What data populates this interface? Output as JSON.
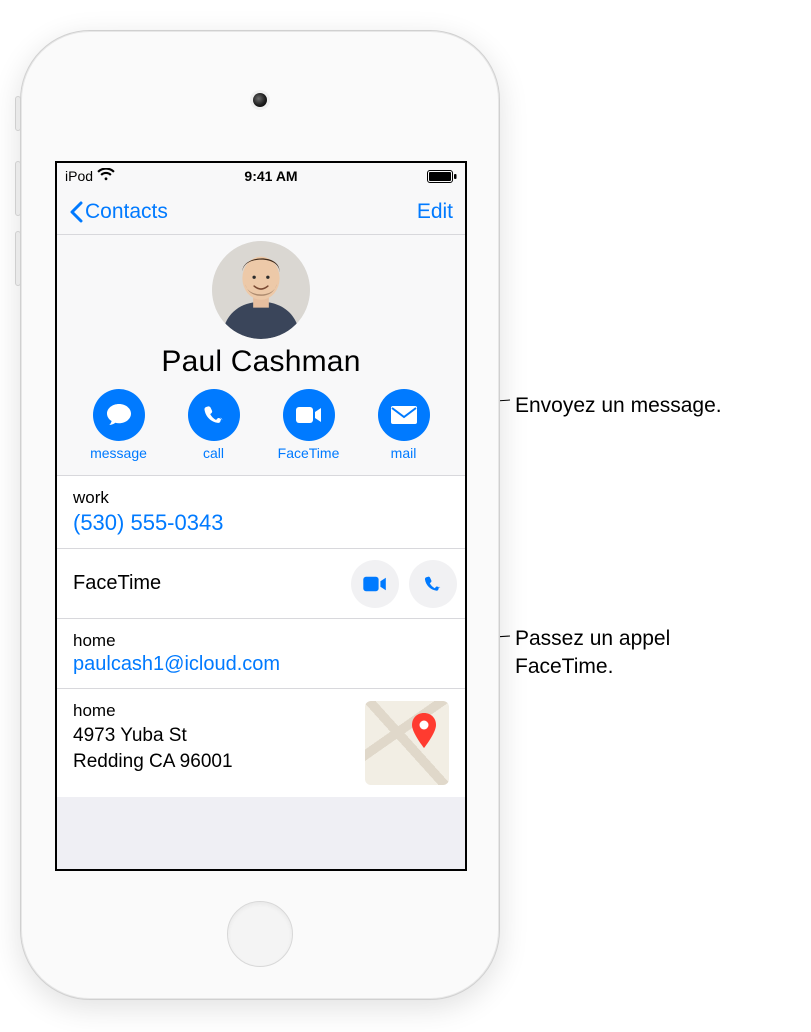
{
  "statusbar": {
    "carrier": "iPod",
    "time": "9:41 AM"
  },
  "navbar": {
    "back_label": "Contacts",
    "edit_label": "Edit"
  },
  "contact": {
    "name": "Paul Cashman",
    "actions": [
      {
        "label": "message"
      },
      {
        "label": "call"
      },
      {
        "label": "FaceTime"
      },
      {
        "label": "mail"
      }
    ],
    "phone": {
      "label": "work",
      "value": "(530) 555-0343"
    },
    "facetime": {
      "label": "FaceTime"
    },
    "email": {
      "label": "home",
      "value": "paulcash1@icloud.com"
    },
    "address": {
      "label": "home",
      "line1": "4973 Yuba St",
      "line2": "Redding CA 96001"
    }
  },
  "callouts": {
    "c1": "Envoyez un message.",
    "c2_line1": "Passez un appel",
    "c2_line2": "FaceTime."
  }
}
